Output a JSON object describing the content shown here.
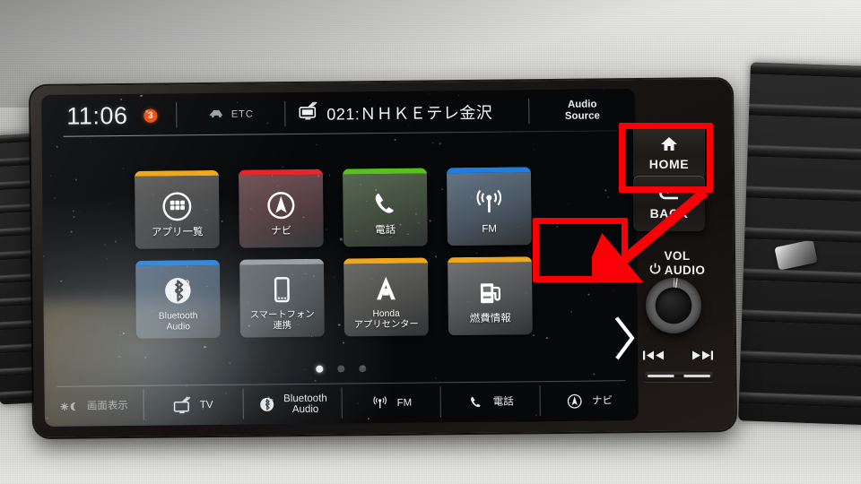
{
  "status_bar": {
    "clock": "11:06",
    "notification_count": "3",
    "etc_label": "ETC",
    "channel": "021:ＮＨＫＥテレ金沢",
    "audio_source_line1": "Audio",
    "audio_source_line2": "Source"
  },
  "home_screen": {
    "tiles": [
      {
        "label": "アプリ一覧",
        "icon": "apps-grid-icon",
        "accent": "#f2a71b",
        "tint": "#6a6a6a",
        "two_line": false
      },
      {
        "label": "ナビ",
        "icon": "navigation-compass-icon",
        "accent": "#e8252a",
        "tint": "#7a5a5e",
        "two_line": false
      },
      {
        "label": "電話",
        "icon": "phone-handset-icon",
        "accent": "#57c11a",
        "tint": "#5e6f58",
        "two_line": false
      },
      {
        "label": "FM",
        "icon": "radio-broadcast-icon",
        "accent": "#1b7fe0",
        "tint": "#6b7c8d",
        "two_line": false
      },
      {
        "label": "Bluetooth\nAudio",
        "icon": "bluetooth-icon",
        "accent": "#1b7fe0",
        "tint": "#5d6f85",
        "two_line": true
      },
      {
        "label": "スマートフォン\n連携",
        "icon": "smartphone-icon",
        "accent": "#9aa0a6",
        "tint": "#6e7377",
        "two_line": true
      },
      {
        "label": "Honda\nアプリセンター",
        "icon": "honda-app-center-icon",
        "accent": "#f2a71b",
        "tint": "#70706c",
        "two_line": true
      },
      {
        "label": "燃費情報",
        "icon": "fuel-pump-icon",
        "accent": "#f2a71b",
        "tint": "#76787a",
        "two_line": false
      }
    ],
    "page_dots": {
      "count": 3,
      "active_index": 0
    },
    "next_page_chevron": "chevron-right-icon"
  },
  "dock": {
    "items": [
      {
        "label": "画面表示",
        "icon": "brightness-moon-icon",
        "dim": true
      },
      {
        "label": "TV",
        "icon": "tv-icon",
        "dim": false
      },
      {
        "label": "Bluetooth\nAudio",
        "icon": "bluetooth-icon",
        "dim": false
      },
      {
        "label": "FM",
        "icon": "radio-broadcast-icon",
        "dim": false
      },
      {
        "label": "電話",
        "icon": "phone-handset-icon",
        "dim": false
      },
      {
        "label": "ナビ",
        "icon": "navigation-compass-icon",
        "dim": false
      }
    ]
  },
  "hard_buttons": {
    "home": {
      "label": "HOME",
      "icon": "house-icon"
    },
    "back": {
      "label": "BACK",
      "icon": "back-arrow-icon"
    },
    "volume": {
      "line1": "VOL",
      "line2": "AUDIO",
      "power_icon": "power-icon"
    },
    "media": {
      "prev_icon": "previous-track-icon",
      "next_icon": "next-track-icon"
    }
  },
  "annotations": {
    "accent_color": "#fb0007",
    "box_home_target": "HOME",
    "box_chevron_target": "chevron-right-icon",
    "arrow": "arrow-from-home-to-chevron"
  }
}
